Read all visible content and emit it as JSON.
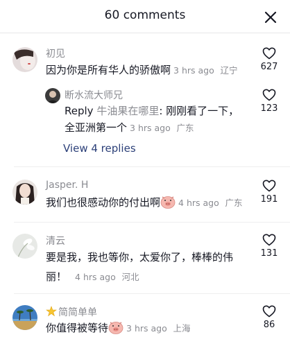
{
  "header": {
    "title": "60 comments"
  },
  "comments": [
    {
      "user": "初见",
      "text": "因为你是所有华人的骄傲啊",
      "time": "3 hrs ago",
      "location": "辽宁",
      "likes": "627",
      "avatar_color": "#d9cfcf"
    }
  ],
  "reply": {
    "user": "断水流大师兄",
    "prefix": "Reply",
    "target": "牛油果在哪里",
    "text": ": 刚刚看了一下，",
    "text2": "全亚洲第一个",
    "time": "3 hrs ago",
    "location": "广东",
    "likes": "123",
    "view_replies": "View 4 replies"
  },
  "comment2": {
    "user": "Jasper. H",
    "text": "我们也很感动你的付出啊",
    "time": "4 hrs ago",
    "location": "广东",
    "likes": "191"
  },
  "comment3": {
    "user": "清云",
    "text": "要是我，我也等你，太爱你了，棒棒的伟",
    "text2": "丽！",
    "time": "4 hrs ago",
    "location": "河北",
    "likes": "131"
  },
  "comment4": {
    "user": "简简单单",
    "text": "你值得被等待",
    "time": "3 hrs ago",
    "location": "上海",
    "likes": "86"
  },
  "icons": [
    "close-icon",
    "heart-icon",
    "pig-emoji-icon",
    "star-badge-icon"
  ],
  "colors": {
    "link": "#2b3f78",
    "muted": "#8a8b91",
    "text": "#161823"
  }
}
